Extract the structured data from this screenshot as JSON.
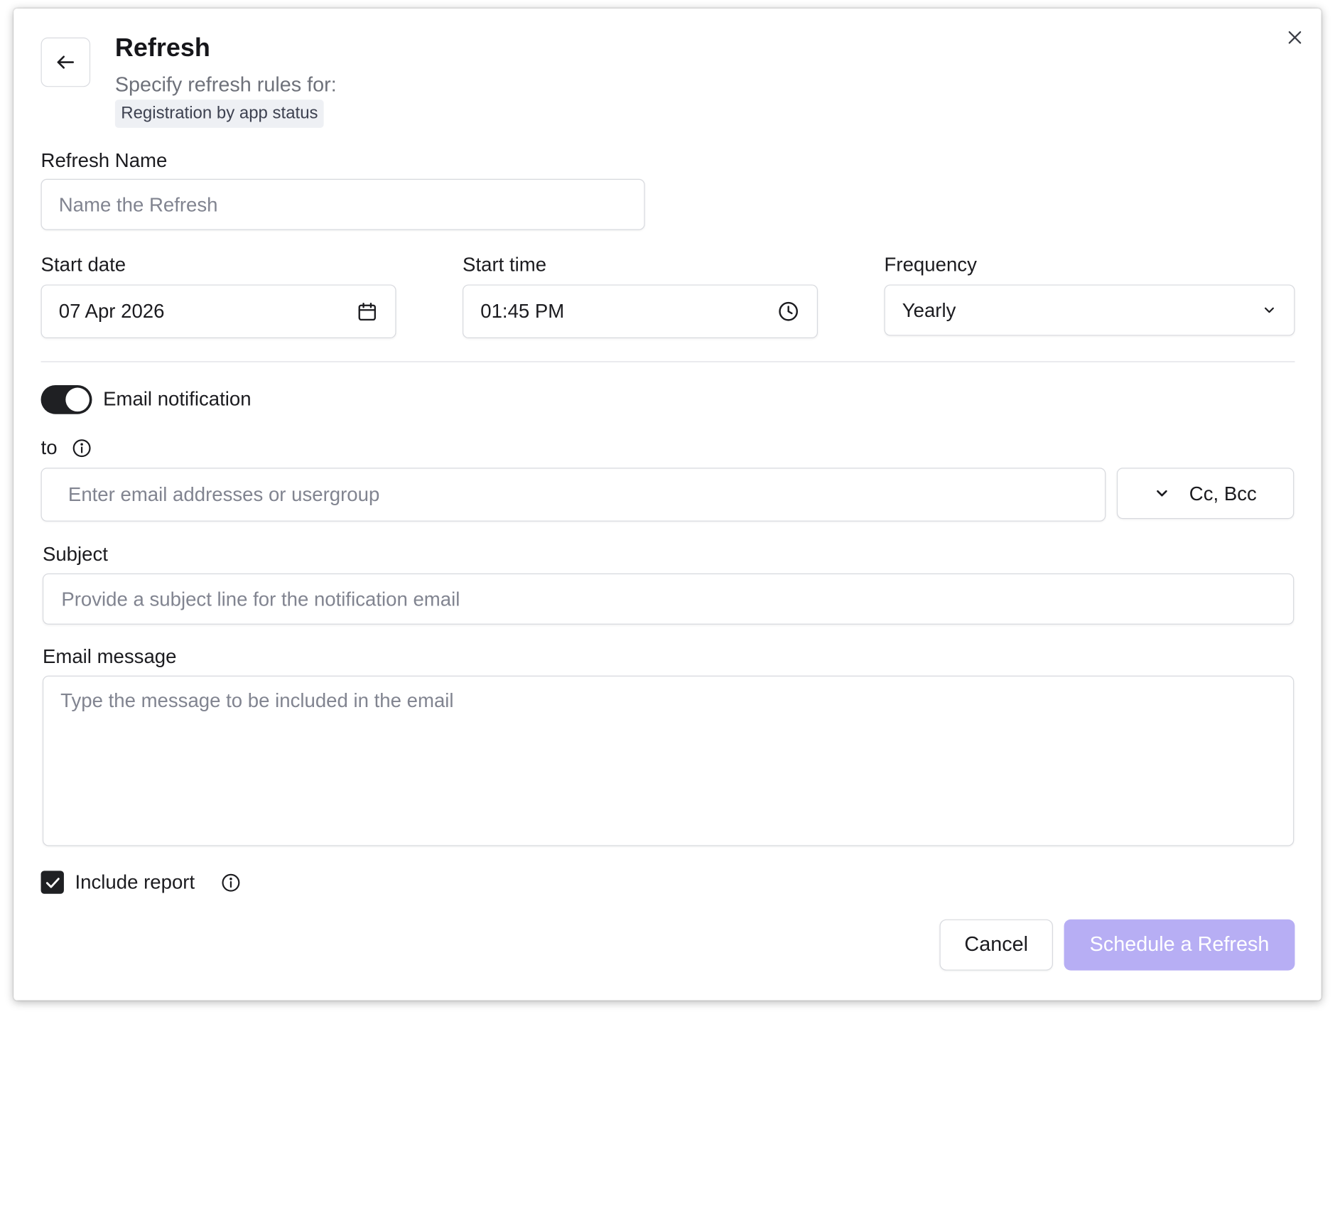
{
  "dialog": {
    "title": "Refresh",
    "subtitle": "Specify refresh rules for:",
    "report_name": "Registration by app status"
  },
  "form": {
    "refresh_name": {
      "label": "Refresh Name",
      "placeholder": "Name the Refresh",
      "value": ""
    },
    "start_date": {
      "label": "Start date",
      "value": "07 Apr 2026"
    },
    "start_time": {
      "label": "Start time",
      "value": "01:45 PM"
    },
    "frequency": {
      "label": "Frequency",
      "value": "Yearly"
    },
    "email_notification": {
      "label": "Email notification",
      "enabled": true
    },
    "to": {
      "label": "to",
      "placeholder": "Enter email addresses or usergroup",
      "cc_bcc_label": "Cc, Bcc"
    },
    "subject": {
      "label": "Subject",
      "placeholder": "Provide a subject line for the notification email"
    },
    "message": {
      "label": "Email message",
      "placeholder": "Type the message to be included in the email"
    },
    "include_report": {
      "label": "Include report",
      "checked": true
    }
  },
  "actions": {
    "cancel_label": "Cancel",
    "submit_label": "Schedule a Refresh"
  },
  "icons": {
    "back": "arrow-left-icon",
    "close": "close-icon",
    "date": "calendar-icon",
    "time": "clock-icon",
    "frequency": "chevron-down-icon",
    "info": "info-icon",
    "checkbox": "checkmark-icon"
  },
  "colors": {
    "primary_button": "#b7aef4",
    "toggle_on": "#1f2023",
    "chip_background": "#eef0f4"
  }
}
